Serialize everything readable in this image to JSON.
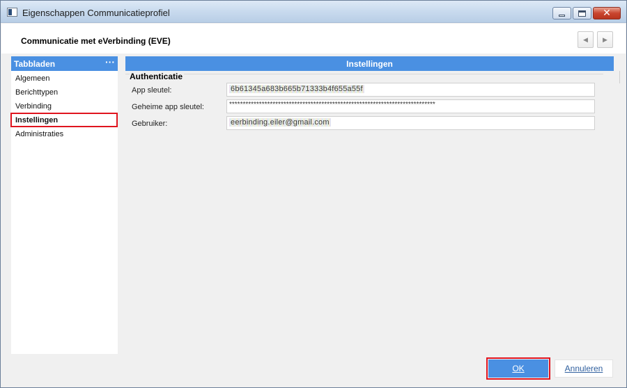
{
  "window": {
    "title": "Eigenschappen Communicatieprofiel",
    "controls": {
      "minimize": "minimize",
      "maximize": "maximize",
      "close": "✕"
    }
  },
  "header": {
    "title": "Communicatie met eVerbinding (EVE)",
    "prev_glyph": "◀",
    "next_glyph": "▶"
  },
  "sidebar": {
    "title": "Tabbladen",
    "more_glyph": "···",
    "items": [
      {
        "label": "Algemeen",
        "active": false
      },
      {
        "label": "Berichttypen",
        "active": false
      },
      {
        "label": "Verbinding",
        "active": false
      },
      {
        "label": "Instellingen",
        "active": true
      },
      {
        "label": "Administraties",
        "active": false
      }
    ]
  },
  "panel": {
    "title": "Instellingen",
    "group_title": "Authenticatie",
    "fields": [
      {
        "label": "App sleutel:",
        "value": "6b61345a683b665b71333b4f655a55f"
      },
      {
        "label": "Geheime app sleutel:",
        "value": "****************************************************************************"
      },
      {
        "label": "Gebruiker:",
        "value": "eerbinding.eiler@gmail.com"
      }
    ]
  },
  "footer": {
    "ok_label": "OK",
    "cancel_label": "Annuleren"
  },
  "colors": {
    "accent": "#4a90e2",
    "highlight": "#e0141e",
    "background": "#f0f0f0"
  }
}
